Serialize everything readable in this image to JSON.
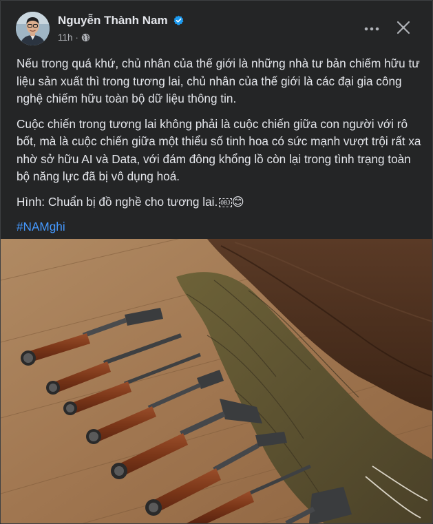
{
  "post": {
    "author": "Nguyễn Thành Nam",
    "time": "11h",
    "separator": "·",
    "paragraphs": [
      "Nếu trong quá khứ, chủ nhân của thế giới là những nhà tư bản chiếm hữu tư liệu sản xuất thì trong tương lai, chủ nhân của thế giới là các đại gia công nghệ chiếm hữu toàn bộ dữ liệu thông tin.",
      "Cuộc chiến trong tương lai không phải là cuộc chiến giữa con người với rô bốt, mà là cuộc chiến giữa một thiểu số tinh hoa có sức mạnh vượt trội rất xa nhờ sở hữu AI và Data, với đám đông khổng lồ còn lại trong tình trạng toàn bộ năng lực đã bị vô dụng hoá."
    ],
    "caption": "Hình: Chuẩn bị đồ nghề cho tương lai.",
    "obj_marker": "OBJ",
    "emoji": "😊",
    "hashtag": "#NAMghi"
  },
  "icons": {
    "verified": "verified-badge-icon",
    "privacy": "globe-icon",
    "more": "more-options-icon",
    "close": "close-icon"
  },
  "colors": {
    "background": "#242526",
    "text": "#e4e6eb",
    "secondary_text": "#b0b3b8",
    "link": "#4599ff",
    "verified": "#1d9bf0"
  }
}
